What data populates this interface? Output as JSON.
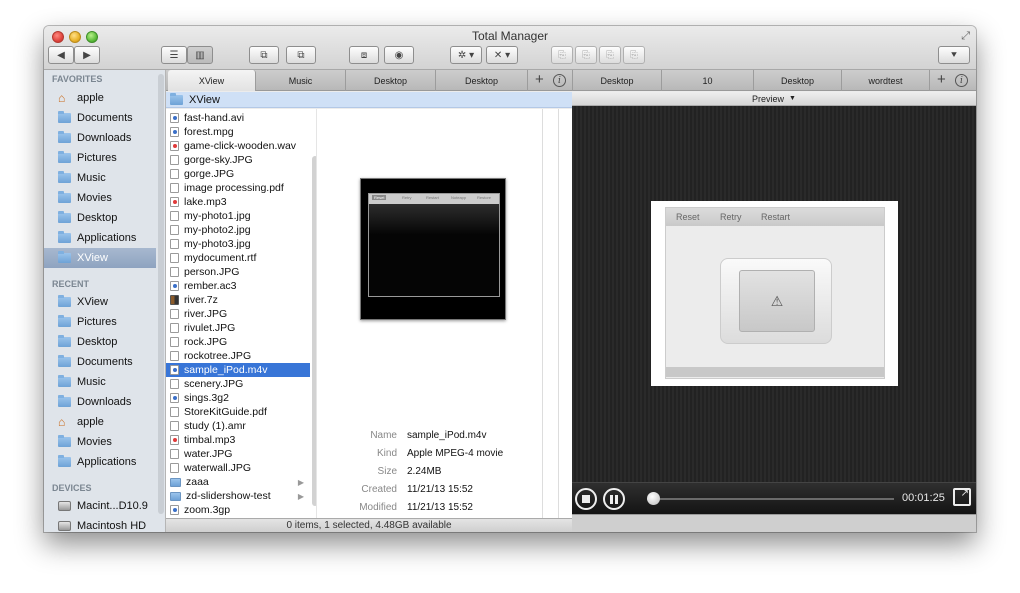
{
  "window": {
    "title": "Total Manager"
  },
  "toolbar": {
    "back": "◀",
    "forward": "▶",
    "view_list": "☰",
    "view_columns": "▥",
    "act1": "⧉",
    "act2": "⧉",
    "act3": "⧈",
    "act4": "◉",
    "gear": "✲ ▾",
    "tools": "✕ ▾",
    "doc1": "⎘",
    "doc2": "⎘",
    "doc3": "⎘",
    "doc4": "⎘",
    "menu": "⯆"
  },
  "tabs_left": [
    {
      "label": "XView",
      "active": true
    },
    {
      "label": "Music",
      "active": false
    },
    {
      "label": "Desktop",
      "active": false
    },
    {
      "label": "Desktop",
      "active": false
    }
  ],
  "tabs_right": [
    {
      "label": "Desktop"
    },
    {
      "label": "10"
    },
    {
      "label": "Desktop"
    },
    {
      "label": "wordtest"
    }
  ],
  "tab_plus": "+",
  "tab_info": "i",
  "sidebar": {
    "favorites_header": "FAVORITES",
    "favorites": [
      {
        "label": "apple",
        "icon": "home-icon"
      },
      {
        "label": "Documents",
        "icon": "folder-icon"
      },
      {
        "label": "Downloads",
        "icon": "folder-icon"
      },
      {
        "label": "Pictures",
        "icon": "folder-icon"
      },
      {
        "label": "Music",
        "icon": "folder-icon"
      },
      {
        "label": "Movies",
        "icon": "folder-icon"
      },
      {
        "label": "Desktop",
        "icon": "folder-icon"
      },
      {
        "label": "Applications",
        "icon": "folder-icon"
      },
      {
        "label": "XView",
        "icon": "folder-icon",
        "selected": true
      }
    ],
    "recent_header": "RECENT",
    "recent": [
      {
        "label": "XView"
      },
      {
        "label": "Pictures"
      },
      {
        "label": "Desktop"
      },
      {
        "label": "Documents"
      },
      {
        "label": "Music"
      },
      {
        "label": "Downloads"
      },
      {
        "label": "apple"
      },
      {
        "label": "Movies"
      },
      {
        "label": "Applications"
      }
    ],
    "devices_header": "DEVICES",
    "devices": [
      {
        "label": "Macint...D10.9"
      },
      {
        "label": "Macintosh HD"
      }
    ]
  },
  "path": {
    "current": "XView"
  },
  "files": [
    {
      "name": "fast-hand.avi",
      "type": "v"
    },
    {
      "name": "forest.mpg",
      "type": "v"
    },
    {
      "name": "game-click-wooden.wav",
      "type": "a"
    },
    {
      "name": "gorge-sky.JPG",
      "type": "i"
    },
    {
      "name": "gorge.JPG",
      "type": "i"
    },
    {
      "name": "image processing.pdf",
      "type": "i"
    },
    {
      "name": "lake.mp3",
      "type": "a"
    },
    {
      "name": "my-photo1.jpg",
      "type": "i"
    },
    {
      "name": "my-photo2.jpg",
      "type": "i"
    },
    {
      "name": "my-photo3.jpg",
      "type": "i"
    },
    {
      "name": "mydocument.rtf",
      "type": "i"
    },
    {
      "name": "person.JPG",
      "type": "i"
    },
    {
      "name": "rember.ac3",
      "type": "v"
    },
    {
      "name": "river.7z",
      "type": "z"
    },
    {
      "name": "river.JPG",
      "type": "i"
    },
    {
      "name": "rivulet.JPG",
      "type": "i"
    },
    {
      "name": "rock.JPG",
      "type": "i"
    },
    {
      "name": "rockotree.JPG",
      "type": "i"
    },
    {
      "name": "sample_iPod.m4v",
      "type": "v",
      "selected": true
    },
    {
      "name": "scenery.JPG",
      "type": "i"
    },
    {
      "name": "sings.3g2",
      "type": "v"
    },
    {
      "name": "StoreKitGuide.pdf",
      "type": "i"
    },
    {
      "name": "study (1).amr",
      "type": "i"
    },
    {
      "name": "timbal.mp3",
      "type": "a"
    },
    {
      "name": "water.JPG",
      "type": "i"
    },
    {
      "name": "waterwall.JPG",
      "type": "i"
    },
    {
      "name": "zaaa",
      "type": "f",
      "folder": true
    },
    {
      "name": "zd-slidershow-test",
      "type": "f",
      "folder": true
    },
    {
      "name": "zoom.3gp",
      "type": "v"
    }
  ],
  "info": {
    "rows": [
      {
        "label": "Name",
        "value": "sample_iPod.m4v"
      },
      {
        "label": "Kind",
        "value": "Apple MPEG-4 movie"
      },
      {
        "label": "Size",
        "value": "2.24MB"
      },
      {
        "label": "Created",
        "value": "11/21/13 15:52"
      },
      {
        "label": "Modified",
        "value": "11/21/13 15:52"
      }
    ],
    "thumb_tabs": [
      "Reset",
      "Retry",
      "Restart",
      "Noteapp",
      "Restore"
    ]
  },
  "status": {
    "text": "0 items, 1 selected, 4.48GB available"
  },
  "preview": {
    "header": "Preview",
    "header_arrow": "▼",
    "tabs": [
      "Reset",
      "Retry",
      "Restart"
    ],
    "warning": "⚠"
  },
  "player": {
    "time": "00:01:25",
    "progress": 0.02
  }
}
